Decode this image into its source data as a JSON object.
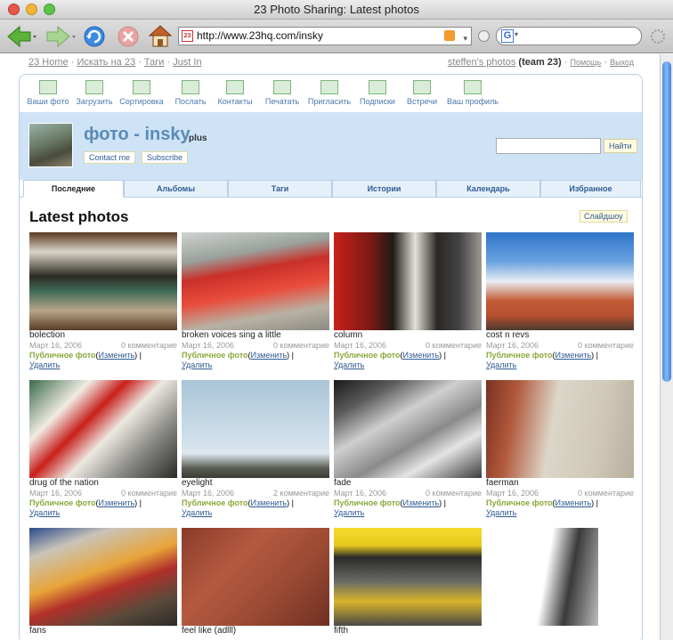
{
  "window": {
    "title": "23 Photo Sharing: Latest photos"
  },
  "browser": {
    "url": "http://www.23hq.com/insky",
    "search_engine_icon": "google-icon"
  },
  "topnav": {
    "home": "23 Home",
    "search": "Искать на 23",
    "tags": "Таги",
    "justin": "Just In",
    "user_photos": "steffen's photos",
    "team": "(team 23)",
    "help": "Помощь",
    "logout": "Выход",
    "sep": "·"
  },
  "icons": [
    {
      "label": "Ваши фото"
    },
    {
      "label": "Загрузить"
    },
    {
      "label": "Сортировка"
    },
    {
      "label": "Послать"
    },
    {
      "label": "Контакты"
    },
    {
      "label": "Печатать"
    },
    {
      "label": "Пригласить"
    },
    {
      "label": "Подписки"
    },
    {
      "label": "Встречи"
    },
    {
      "label": "Ваш профиль"
    }
  ],
  "banner": {
    "title": "фото - insky",
    "plus": "plus",
    "contact": "Contact me",
    "subscribe": "Subscribe",
    "search_button": "Найти"
  },
  "tabs": [
    "Последние",
    "Альбомы",
    "Таги",
    "Истории",
    "Календарь",
    "Избранное"
  ],
  "heading": "Latest photos",
  "slideshow": "Слайдшоу",
  "labels": {
    "public": "Публичное фото",
    "change": "Изменить",
    "delete": "Удалить",
    "open_paren": "(",
    "close_paren": ")",
    "bar": "|"
  },
  "photos": [
    {
      "title": "bolection",
      "date": "Март 16, 2006",
      "comments": "0 комментарие"
    },
    {
      "title": "broken voices sing a little",
      "date": "Март 16, 2006",
      "comments": "0 комментарие"
    },
    {
      "title": "column",
      "date": "Март 16, 2006",
      "comments": "0 комментарие"
    },
    {
      "title": "cost n revs",
      "date": "Март 16, 2006",
      "comments": "0 комментарие"
    },
    {
      "title": "drug of the nation",
      "date": "Март 16, 2006",
      "comments": "0 комментарие"
    },
    {
      "title": "eyelight",
      "date": "Март 16, 2006",
      "comments": "2 комментарие"
    },
    {
      "title": "fade",
      "date": "Март 16, 2006",
      "comments": "0 комментарие"
    },
    {
      "title": "faerman",
      "date": "Март 16, 2006",
      "comments": "0 комментарие"
    },
    {
      "title": "fans",
      "date": "",
      "comments": ""
    },
    {
      "title": "feel like (adlll)",
      "date": "",
      "comments": ""
    },
    {
      "title": "fifth",
      "date": "",
      "comments": ""
    }
  ],
  "colors": {
    "accent": "#5a8bb7",
    "banner_bg": "#cfe3f6",
    "public_green": "#8aa83a",
    "link": "#2f5c94"
  }
}
